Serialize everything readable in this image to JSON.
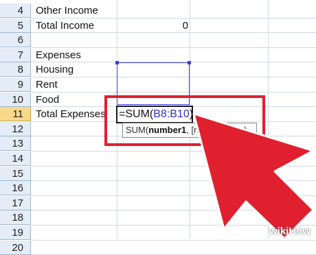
{
  "rows": [
    {
      "num": "4",
      "a": "Other Income",
      "b": ""
    },
    {
      "num": "5",
      "a": "Total Income",
      "b": "0"
    },
    {
      "num": "6",
      "a": "",
      "b": ""
    },
    {
      "num": "7",
      "a": "Expenses",
      "b": ""
    },
    {
      "num": "8",
      "a": "Housing",
      "b": ""
    },
    {
      "num": "9",
      "a": "Rent",
      "b": ""
    },
    {
      "num": "10",
      "a": "Food",
      "b": ""
    },
    {
      "num": "11",
      "a": "Total Expenses",
      "b": ""
    },
    {
      "num": "12",
      "a": "",
      "b": ""
    },
    {
      "num": "13",
      "a": "",
      "b": ""
    },
    {
      "num": "14",
      "a": "",
      "b": ""
    },
    {
      "num": "15",
      "a": "",
      "b": ""
    },
    {
      "num": "16",
      "a": "",
      "b": ""
    },
    {
      "num": "17",
      "a": "",
      "b": ""
    },
    {
      "num": "18",
      "a": "",
      "b": ""
    },
    {
      "num": "19",
      "a": "",
      "b": ""
    },
    {
      "num": "20",
      "a": "",
      "b": ""
    }
  ],
  "active_row": "11",
  "formula": {
    "prefix": "=SUM(",
    "range": "B8:B10",
    "suffix": ")"
  },
  "tooltip": {
    "func": "SUM(",
    "arg_bold": "number1",
    "rest": ", [number2], ...)"
  },
  "colors": {
    "highlight_frame": "#e0202e",
    "arrow": "#e0202e",
    "range_ref": "#3030c8"
  },
  "watermark": "wikiHow"
}
